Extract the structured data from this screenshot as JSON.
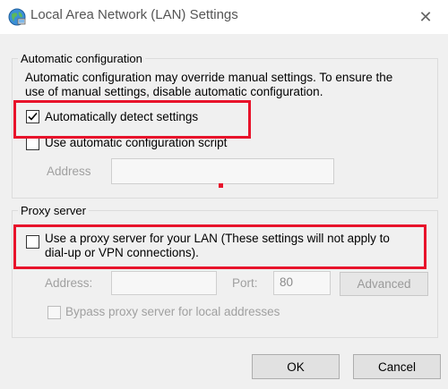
{
  "window": {
    "title": "Local Area Network (LAN) Settings",
    "close_glyph": "✕"
  },
  "auto_config": {
    "legend": "Automatic configuration",
    "description_line1": "Automatic configuration may override manual settings.  To ensure the",
    "description_line2": "use of manual settings, disable automatic configuration.",
    "detect_settings": {
      "label": "Automatically detect settings",
      "checked": true
    },
    "use_script": {
      "label": "Use automatic configuration script",
      "checked": false
    },
    "address_label": "Address",
    "address_value": ""
  },
  "proxy": {
    "legend": "Proxy server",
    "use_proxy": {
      "label_line1": "Use a proxy server for your LAN (These settings will not apply to",
      "label_line2": "dial-up or VPN connections).",
      "checked": false
    },
    "address_label": "Address:",
    "address_value": "",
    "port_label": "Port:",
    "port_value": "80",
    "advanced_label": "Advanced",
    "bypass_label": "Bypass proxy server for local addresses"
  },
  "buttons": {
    "ok": "OK",
    "cancel": "Cancel"
  },
  "colors": {
    "highlight": "#e8132b",
    "dialog_bg": "#f0f0f0"
  }
}
